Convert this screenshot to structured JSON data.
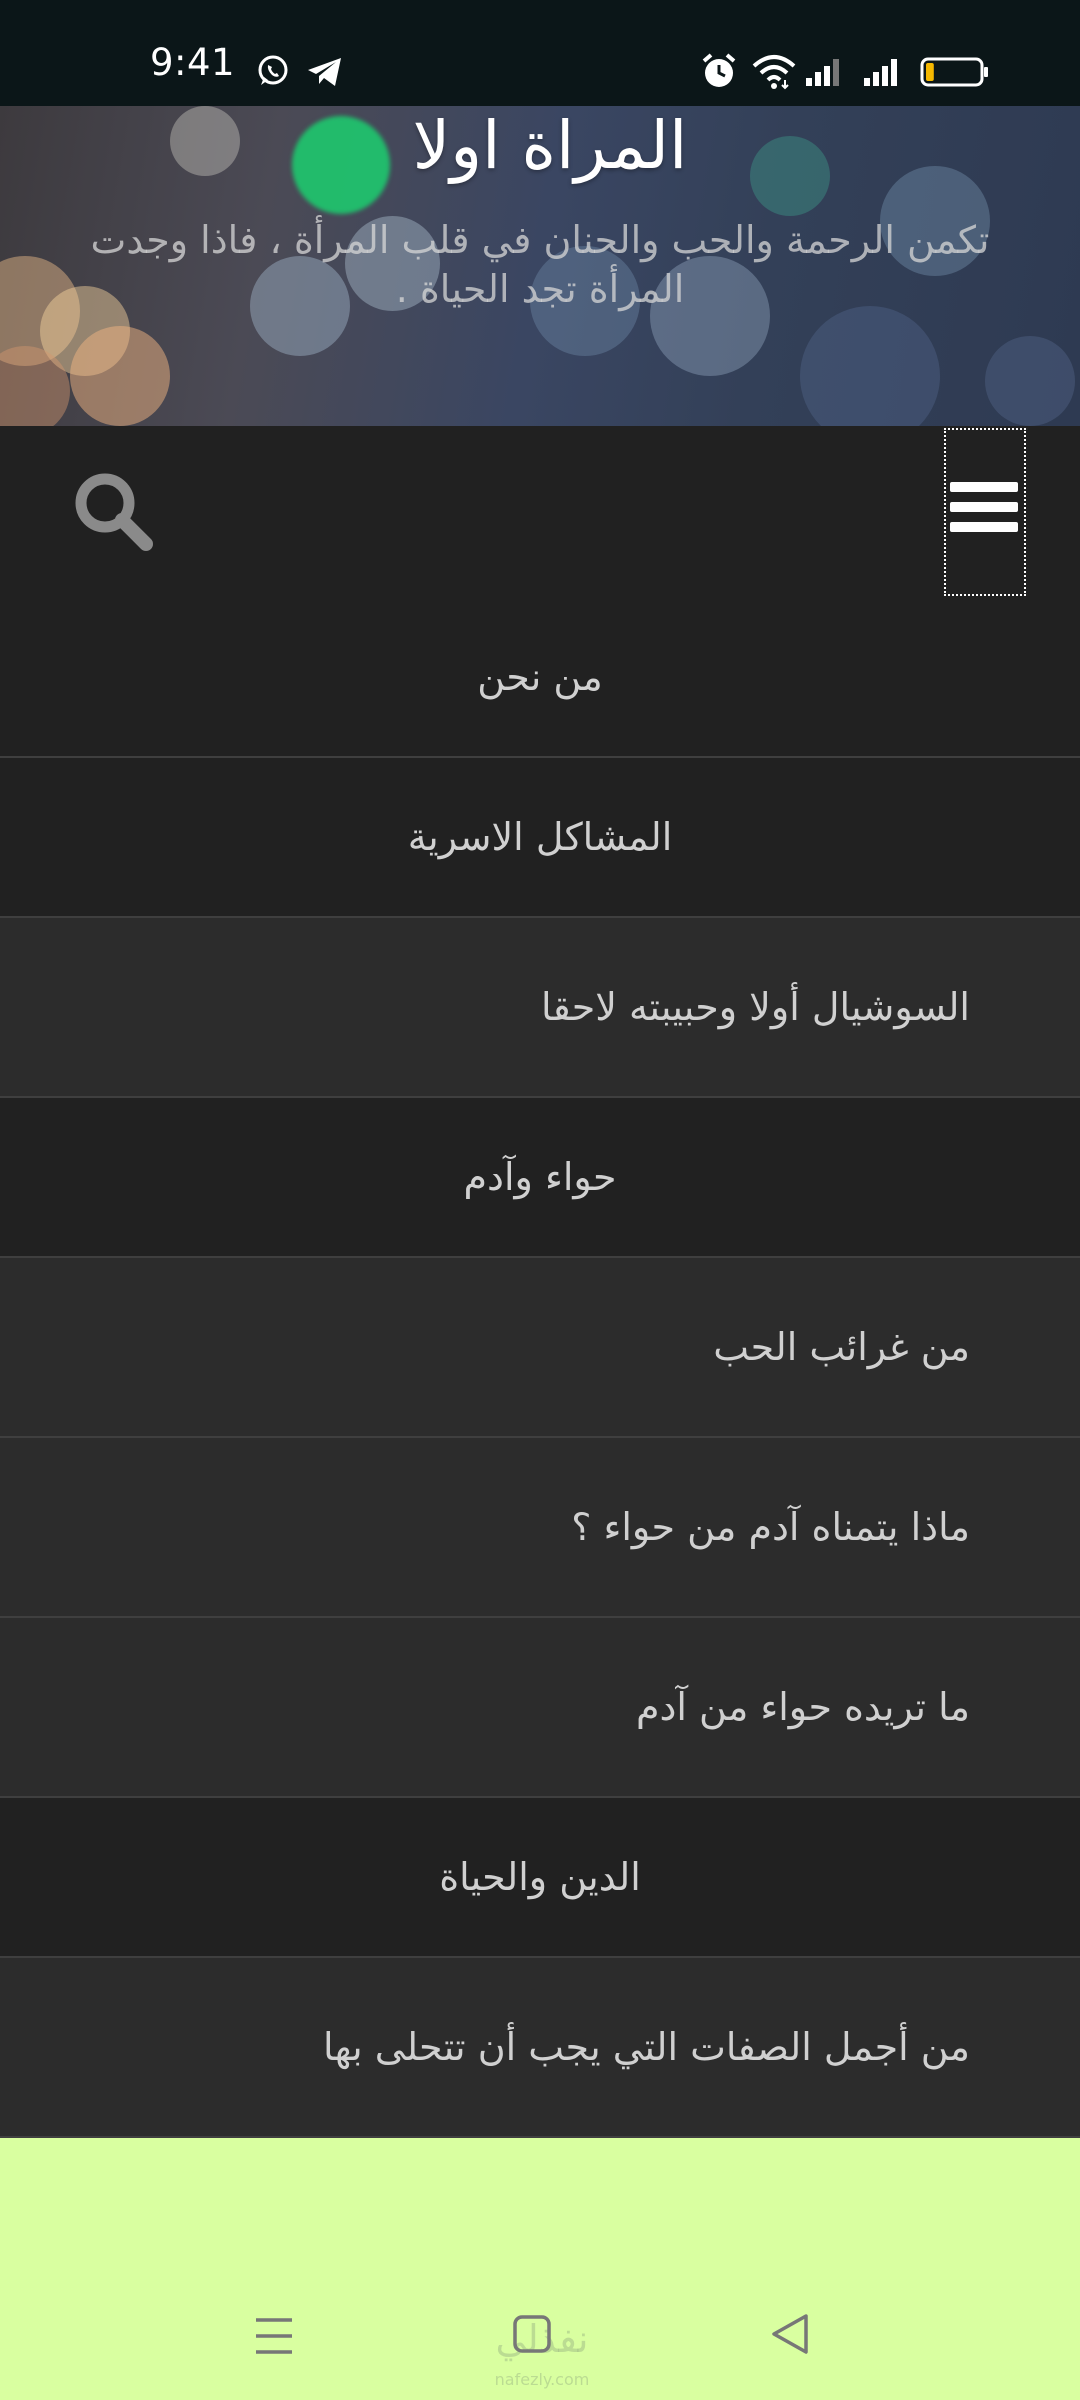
{
  "status_bar": {
    "time": "9:41",
    "icons": [
      "whatsapp-icon",
      "telegram-icon",
      "alarm-icon",
      "wifi-icon",
      "signal-icon",
      "signal-icon",
      "battery-icon"
    ],
    "battery_level": 0.15,
    "battery_color": "#f5b800"
  },
  "header": {
    "title": "المراة اولا",
    "tagline": "تكمن الرحمة والحب والحنان في قلب المرأة ، فاذا وجدت المرأة تجد الحياة ."
  },
  "navbar": {
    "search_icon": "search-icon",
    "menu_icon": "hamburger-menu-icon"
  },
  "menu": {
    "items": [
      {
        "label": "من نحن",
        "level": "top"
      },
      {
        "label": "المشاكل الاسرية",
        "level": "top"
      },
      {
        "label": "السوشيال أولا وحبيبته لاحقا",
        "level": "sub"
      },
      {
        "label": "حواء وآدم",
        "level": "top"
      },
      {
        "label": "من غرائب الحب",
        "level": "sub"
      },
      {
        "label": "ماذا يتمناه آدم من حواء ؟",
        "level": "sub"
      },
      {
        "label": "ما تريده حواء من آدم",
        "level": "sub"
      },
      {
        "label": "الدين والحياة",
        "level": "top"
      },
      {
        "label": "من أجمل الصفات التي يجب أن تتحلى بها",
        "level": "sub"
      }
    ]
  },
  "bottom_nav": {
    "buttons": [
      "recents-icon",
      "home-icon",
      "back-icon"
    ],
    "background": "#d9ffa0",
    "watermark": "نفذلي",
    "watermark_sub": "nafezly.com"
  },
  "colors": {
    "status_bar_bg": "#0b1618",
    "navbar_bg": "#212121",
    "menu_top_bg": "#212121",
    "menu_sub_bg": "#2c2c2c",
    "menu_text": "#d0d0d0"
  }
}
